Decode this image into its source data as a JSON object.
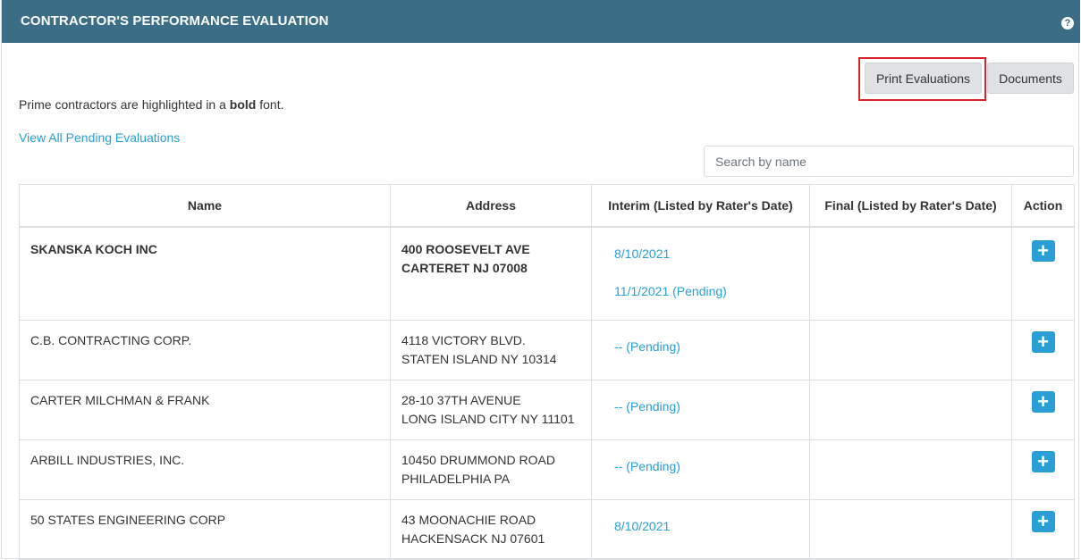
{
  "header": {
    "title": "CONTRACTOR'S PERFORMANCE EVALUATION",
    "help_icon": "?"
  },
  "toolbar": {
    "print_label": "Print Evaluations",
    "documents_label": "Documents"
  },
  "note": {
    "prefix": "Prime contractors are highlighted in a ",
    "bold_word": "bold",
    "suffix": " font."
  },
  "pending_link": "View All Pending Evaluations",
  "search": {
    "placeholder": "Search by name",
    "value": ""
  },
  "table": {
    "columns": [
      "Name",
      "Address",
      "Interim (Listed by Rater's Date)",
      "Final (Listed by Rater's Date)",
      "Action"
    ],
    "rows": [
      {
        "name": "SKANSKA KOCH INC",
        "address1": "400 ROOSEVELT AVE",
        "address2": "CARTERET  NJ 07008",
        "interim": [
          "8/10/2021",
          "11/1/2021 (Pending)"
        ],
        "final": "",
        "bold": true
      },
      {
        "name": "C.B. CONTRACTING CORP.",
        "address1": "4118 VICTORY BLVD.",
        "address2": "STATEN ISLAND  NY 10314",
        "interim": [
          "-- (Pending)"
        ],
        "final": "",
        "bold": false
      },
      {
        "name": "CARTER MILCHMAN & FRANK",
        "address1": "28-10 37TH AVENUE",
        "address2": "LONG ISLAND CITY  NY 11101",
        "interim": [
          "-- (Pending)"
        ],
        "final": "",
        "bold": false
      },
      {
        "name": "ARBILL INDUSTRIES, INC.",
        "address1": "10450 DRUMMOND ROAD",
        "address2": "PHILADELPHIA  PA",
        "interim": [
          "-- (Pending)"
        ],
        "final": "",
        "bold": false
      },
      {
        "name": "50 STATES ENGINEERING CORP",
        "address1": "43 MOONACHIE ROAD",
        "address2": "HACKENSACK  NJ 07601",
        "interim": [
          "8/10/2021"
        ],
        "final": "",
        "bold": false
      }
    ],
    "add_icon": "+"
  },
  "colors": {
    "header_bg": "#3b6e86",
    "link": "#2a9fd6",
    "highlight": "#d9242b"
  }
}
